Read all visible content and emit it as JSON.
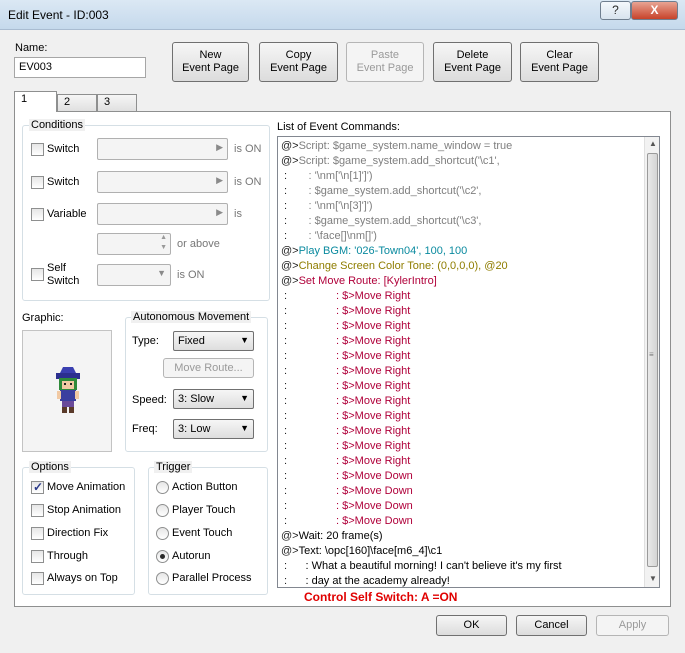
{
  "window": {
    "title": "Edit Event - ID:003"
  },
  "titlebar": {
    "help": "?",
    "close": "X"
  },
  "name": {
    "label": "Name:",
    "value": "EV003"
  },
  "toolbar": {
    "new": [
      "New",
      "Event Page"
    ],
    "copy": [
      "Copy",
      "Event Page"
    ],
    "paste": [
      "Paste",
      "Event Page"
    ],
    "delete": [
      "Delete",
      "Event Page"
    ],
    "clear": [
      "Clear",
      "Event Page"
    ]
  },
  "tabs": [
    "1",
    "2",
    "3"
  ],
  "conditions": {
    "label": "Conditions",
    "switch1": "Switch",
    "switch2": "Switch",
    "variable": "Variable",
    "self_switch": [
      "Self",
      "Switch"
    ],
    "is_on": "is ON",
    "is": "is",
    "or_above": "or above"
  },
  "graphic": {
    "label": "Graphic:"
  },
  "autonomous": {
    "label": "Autonomous Movement",
    "type_label": "Type:",
    "type_value": "Fixed",
    "move_route": "Move Route...",
    "speed_label": "Speed:",
    "speed_value": "3: Slow",
    "freq_label": "Freq:",
    "freq_value": "3: Low"
  },
  "options": {
    "label": "Options",
    "items": [
      {
        "label": "Move Animation",
        "checked": true
      },
      {
        "label": "Stop Animation",
        "checked": false
      },
      {
        "label": "Direction Fix",
        "checked": false
      },
      {
        "label": "Through",
        "checked": false
      },
      {
        "label": "Always on Top",
        "checked": false
      }
    ]
  },
  "trigger": {
    "label": "Trigger",
    "items": [
      {
        "label": "Action Button",
        "selected": false
      },
      {
        "label": "Player Touch",
        "selected": false
      },
      {
        "label": "Event Touch",
        "selected": false
      },
      {
        "label": "Autorun",
        "selected": true
      },
      {
        "label": "Parallel Process",
        "selected": false
      }
    ]
  },
  "commands": {
    "label": "List of Event Commands:",
    "lines": [
      {
        "p": "@>",
        "t": "Script: $game_system.name_window = true",
        "c": "gray"
      },
      {
        "p": "@>",
        "t": "Script: $game_system.add_shortcut('\\c1',",
        "c": "gray"
      },
      {
        "p": " :",
        "t": "       : '\\nm['\\n[1]']')",
        "c": "gray"
      },
      {
        "p": " :",
        "t": "       : $game_system.add_shortcut('\\c2',",
        "c": "gray"
      },
      {
        "p": " :",
        "t": "       : '\\nm['\\n[3]']')",
        "c": "gray"
      },
      {
        "p": " :",
        "t": "       : $game_system.add_shortcut('\\c3',",
        "c": "gray"
      },
      {
        "p": " :",
        "t": "       : '\\face[]\\nm[]')",
        "c": "gray"
      },
      {
        "p": "@>",
        "t": "Play BGM: '026-Town04', 100, 100",
        "c": "teal"
      },
      {
        "p": "@>",
        "t": "Change Screen Color Tone: (0,0,0,0), @20",
        "c": "olive"
      },
      {
        "p": "@>",
        "t": "Set Move Route: [KylerIntro]",
        "c": "red"
      },
      {
        "p": " :",
        "t": "                : $>Move Right",
        "c": "red"
      },
      {
        "p": " :",
        "t": "                : $>Move Right",
        "c": "red"
      },
      {
        "p": " :",
        "t": "                : $>Move Right",
        "c": "red"
      },
      {
        "p": " :",
        "t": "                : $>Move Right",
        "c": "red"
      },
      {
        "p": " :",
        "t": "                : $>Move Right",
        "c": "red"
      },
      {
        "p": " :",
        "t": "                : $>Move Right",
        "c": "red"
      },
      {
        "p": " :",
        "t": "                : $>Move Right",
        "c": "red"
      },
      {
        "p": " :",
        "t": "                : $>Move Right",
        "c": "red"
      },
      {
        "p": " :",
        "t": "                : $>Move Right",
        "c": "red"
      },
      {
        "p": " :",
        "t": "                : $>Move Right",
        "c": "red"
      },
      {
        "p": " :",
        "t": "                : $>Move Right",
        "c": "red"
      },
      {
        "p": " :",
        "t": "                : $>Move Right",
        "c": "red"
      },
      {
        "p": " :",
        "t": "                : $>Move Down",
        "c": "red"
      },
      {
        "p": " :",
        "t": "                : $>Move Down",
        "c": "red"
      },
      {
        "p": " :",
        "t": "                : $>Move Down",
        "c": "red"
      },
      {
        "p": " :",
        "t": "                : $>Move Down",
        "c": "red"
      },
      {
        "p": "@>",
        "t": "Wait: 20 frame(s)",
        "c": "black"
      },
      {
        "p": "@>",
        "t": "Text: \\opc[160]\\face[m6_4]\\c1",
        "c": "black"
      },
      {
        "p": " :",
        "t": "      : What a beautiful morning! I can't believe it's my first",
        "c": "black"
      },
      {
        "p": " :",
        "t": "      : day at the academy already!",
        "c": "black"
      }
    ]
  },
  "annotation": "Control Self Switch:  A =ON",
  "footer": {
    "ok": "OK",
    "cancel": "Cancel",
    "apply": "Apply"
  },
  "colors": {
    "gray": "#7f7f7f",
    "teal": "#0a8a9f",
    "olive": "#8f7d00",
    "red": "#b0003a",
    "black": "#000000",
    "annotation": "#e00000"
  }
}
